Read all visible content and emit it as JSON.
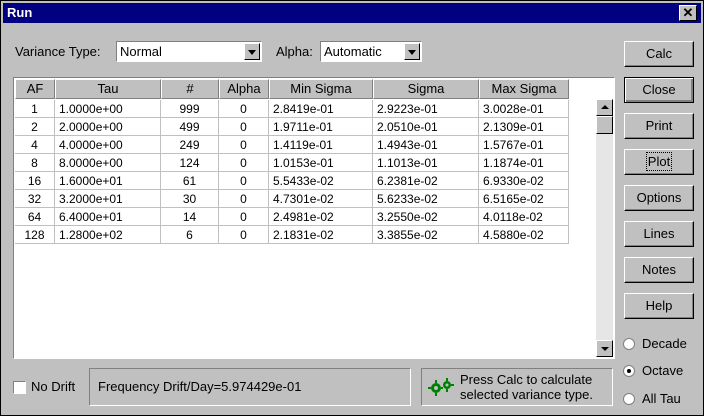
{
  "window": {
    "title": "Run",
    "close_glyph": "✕"
  },
  "controls": {
    "variance_type_label": "Variance Type:",
    "variance_type_value": "Normal",
    "alpha_label": "Alpha:",
    "alpha_value": "Automatic"
  },
  "table": {
    "columns": [
      "AF",
      "Tau",
      "#",
      "Alpha",
      "Min Sigma",
      "Sigma",
      "Max Sigma"
    ],
    "rows": [
      [
        "1",
        "1.0000e+00",
        "999",
        "0",
        "2.8419e-01",
        "2.9223e-01",
        "3.0028e-01"
      ],
      [
        "2",
        "2.0000e+00",
        "499",
        "0",
        "1.9711e-01",
        "2.0510e-01",
        "2.1309e-01"
      ],
      [
        "4",
        "4.0000e+00",
        "249",
        "0",
        "1.4119e-01",
        "1.4943e-01",
        "1.5767e-01"
      ],
      [
        "8",
        "8.0000e+00",
        "124",
        "0",
        "1.0153e-01",
        "1.1013e-01",
        "1.1874e-01"
      ],
      [
        "16",
        "1.6000e+01",
        "61",
        "0",
        "5.5433e-02",
        "6.2381e-02",
        "6.9330e-02"
      ],
      [
        "32",
        "3.2000e+01",
        "30",
        "0",
        "4.7301e-02",
        "5.6233e-02",
        "6.5165e-02"
      ],
      [
        "64",
        "6.4000e+01",
        "14",
        "0",
        "2.4981e-02",
        "3.2550e-02",
        "4.0118e-02"
      ],
      [
        "128",
        "1.2800e+02",
        "6",
        "0",
        "2.1831e-02",
        "3.3855e-02",
        "4.5880e-02"
      ]
    ]
  },
  "buttons": [
    "Calc",
    "Close",
    "Print",
    "Plot",
    "Options",
    "Lines",
    "Notes",
    "Help"
  ],
  "radios": [
    {
      "label": "Decade",
      "checked": false
    },
    {
      "label": "Octave",
      "checked": true
    },
    {
      "label": "All Tau",
      "checked": false
    }
  ],
  "bottom": {
    "no_drift_label": "No Drift",
    "drift_text": "Frequency Drift/Day=5.974429e-01",
    "status_text_1": "Press Calc to calculate",
    "status_text_2": "selected variance type.",
    "status_icon": "gears-icon",
    "status_icon_color": "#008000"
  }
}
